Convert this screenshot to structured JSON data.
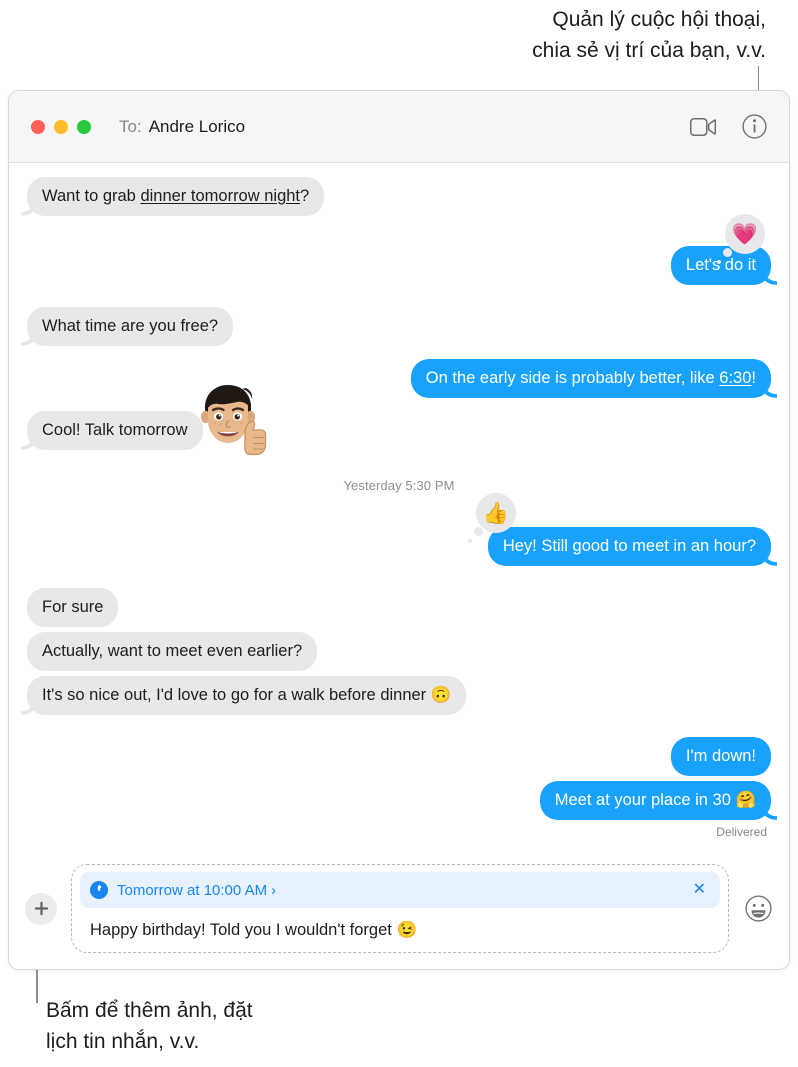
{
  "callouts": {
    "top": "Quản lý cuộc hội thoại,\nchia sẻ vị trí của bạn, v.v.",
    "bottom": "Bấm để thêm ảnh, đặt\nlịch tin nhắn, v.v."
  },
  "window": {
    "titlebar": {
      "to_label": "To:",
      "to_value": "Andre Lorico",
      "buttons": {
        "close": "close",
        "minimize": "minimize",
        "zoom": "zoom"
      },
      "actions": {
        "facetime": "FaceTime video",
        "details": "Details"
      }
    },
    "conversation": {
      "messages": [
        {
          "id": "m1",
          "side": "them",
          "text_before": "Want to grab ",
          "text_link": "dinner tomorrow night",
          "text_after": "?",
          "tail": true
        },
        {
          "id": "m2",
          "side": "me",
          "text": "Let's do it",
          "tail": true,
          "tapback": "💗"
        },
        {
          "id": "m3",
          "side": "them",
          "text": "What time are you free?",
          "tail": true
        },
        {
          "id": "m4",
          "side": "me",
          "text_before": "On the early side is probably better, like ",
          "text_link": "6:30",
          "text_after": "!",
          "tail": true
        },
        {
          "id": "m5",
          "side": "them",
          "text": "Cool! Talk tomorrow",
          "tail": true,
          "sticker": "memoji-thumbs-up"
        }
      ],
      "timestamp": "Yesterday 5:30 PM",
      "messages2": [
        {
          "id": "m6",
          "side": "me",
          "text": "Hey! Still good to meet in an hour?",
          "tail": true,
          "tapback": "👍"
        },
        {
          "id": "m7",
          "side": "them",
          "text": "For sure",
          "tail": false
        },
        {
          "id": "m8",
          "side": "them",
          "text": "Actually, want to meet even earlier?",
          "tail": false
        },
        {
          "id": "m9",
          "side": "them",
          "text": "It's so nice out, I'd love to go for a walk before dinner 🙃",
          "tail": true
        },
        {
          "id": "m10",
          "side": "me",
          "text": "I'm down!",
          "tail": false
        },
        {
          "id": "m11",
          "side": "me",
          "text": "Meet at your place in 30 🤗",
          "tail": true
        }
      ],
      "delivered_label": "Delivered"
    },
    "composer": {
      "add_button": "+",
      "schedule": {
        "label": "Tomorrow at 10:00 AM",
        "chevron": "›",
        "close": "✕",
        "icon": "clock-icon"
      },
      "draft": "Happy birthday! Told you I wouldn't forget 😉",
      "emoji_button": "emoji-icon"
    }
  },
  "colors": {
    "accent_blue": "#18a2fb",
    "link_blue": "#1787ef",
    "them_bubble": "#e8e8ea",
    "banner_bg": "#e8f2fe",
    "traffic_red": "#ff6159",
    "traffic_yellow": "#ffbd2e",
    "traffic_green": "#28c93f"
  }
}
